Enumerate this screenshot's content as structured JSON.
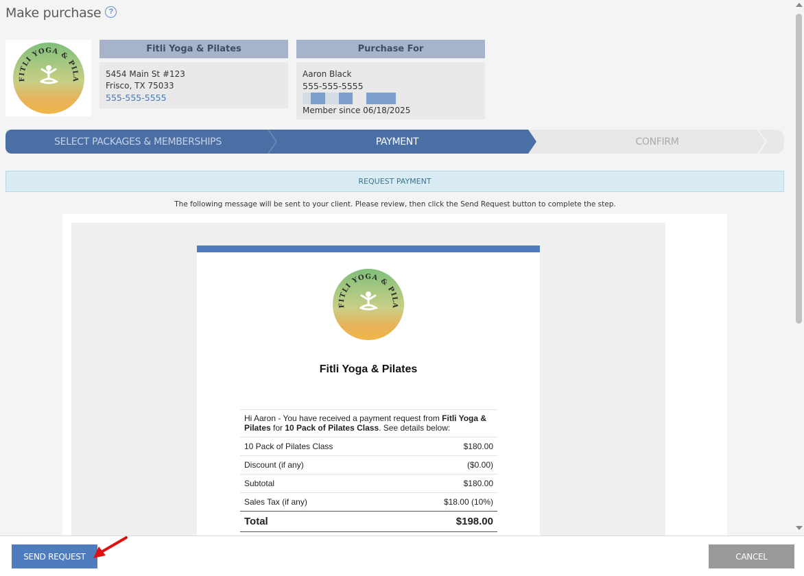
{
  "header": {
    "title": "Make purchase",
    "help_icon": "question-circle-icon"
  },
  "business": {
    "name": "Fitli Yoga & Pilates",
    "address_line1": "5454 Main St #123",
    "address_line2": "Frisco, TX 75033",
    "phone": "555-555-5555",
    "logo_text": "FITLI YOGA & PILATES"
  },
  "purchase_for": {
    "heading": "Purchase For",
    "name": "Aaron Black",
    "phone": "555-555-5555",
    "member_since": "Member since 06/18/2025"
  },
  "steps": [
    {
      "label": "SELECT PACKAGES & MEMBERSHIPS",
      "state": "done"
    },
    {
      "label": "PAYMENT",
      "state": "active"
    },
    {
      "label": "CONFIRM",
      "state": "pending"
    }
  ],
  "request_bar": {
    "label": "REQUEST PAYMENT"
  },
  "instructions": "The following message will be sent to your client.  Please review, then click the Send Request  button to complete the step.",
  "email": {
    "business_name": "Fitli Yoga & Pilates",
    "greeting_prefix": "Hi Aaron - You have received a payment request from ",
    "greeting_business": "Fitli Yoga & Pilates",
    "greeting_for": " for ",
    "greeting_item": "10 Pack of Pilates Class",
    "greeting_suffix": ". See details below:",
    "lines": [
      {
        "label": "10 Pack of Pilates Class",
        "value": "$180.00"
      },
      {
        "label": "Discount (if any)",
        "value": "($0.00)"
      },
      {
        "label": "Subtotal",
        "value": "$180.00"
      },
      {
        "label": "Sales Tax (if any)",
        "value": "$18.00 (10%)"
      }
    ],
    "total_label": "Total",
    "total_value": "$198.00"
  },
  "footer": {
    "send_label": "SEND REQUEST",
    "cancel_label": "CANCEL"
  },
  "colors": {
    "accent": "#4f7cbc",
    "step_active": "#4a6fa5",
    "step_pending": "#e8e8e8",
    "cancel": "#999999"
  }
}
